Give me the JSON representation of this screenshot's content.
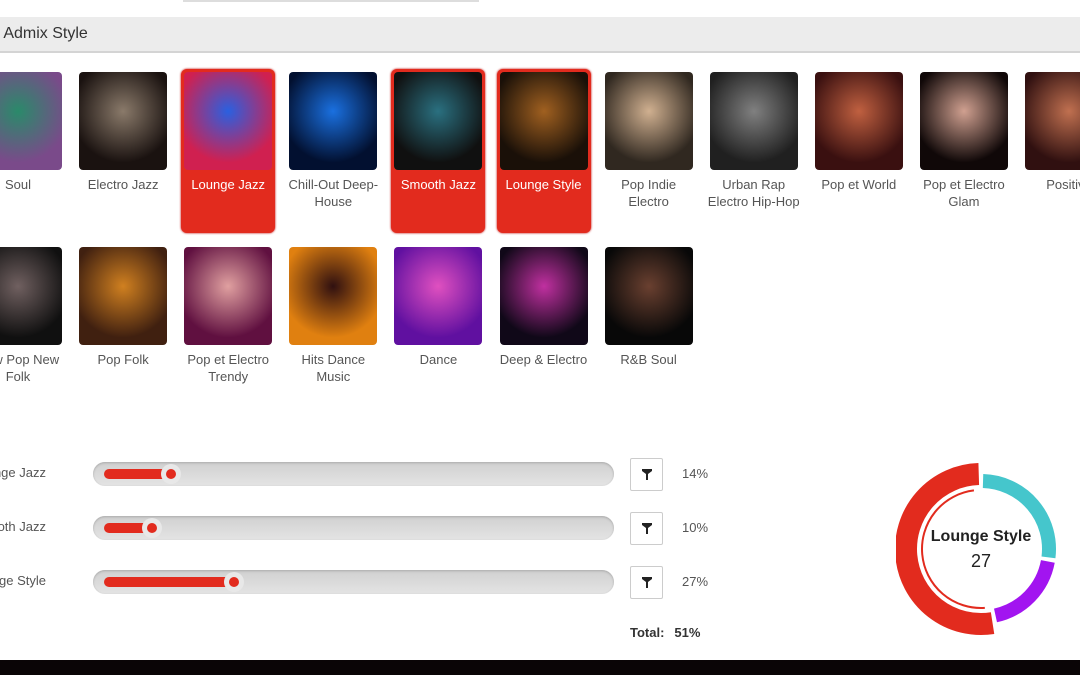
{
  "header": {
    "title": "Music Admix Style"
  },
  "styles": [
    {
      "label": "Soul",
      "selected": false,
      "colors": [
        "#7a4a8a",
        "#2a8a6a"
      ]
    },
    {
      "label": "Electro Jazz",
      "selected": false,
      "colors": [
        "#1a1210",
        "#8a7a6a"
      ]
    },
    {
      "label": "Lounge Jazz",
      "selected": true,
      "colors": [
        "#d02050",
        "#2a60e0"
      ]
    },
    {
      "label": "Chill-Out Deep-House",
      "selected": false,
      "colors": [
        "#021030",
        "#1a70e0"
      ]
    },
    {
      "label": "Smooth Jazz",
      "selected": true,
      "colors": [
        "#101010",
        "#2a7080"
      ]
    },
    {
      "label": "Lounge Style",
      "selected": true,
      "colors": [
        "#1a1008",
        "#a06020"
      ]
    },
    {
      "label": "Pop Indie Electro",
      "selected": false,
      "colors": [
        "#302820",
        "#d0b090"
      ]
    },
    {
      "label": "Urban Rap Electro Hip-Hop",
      "selected": false,
      "colors": [
        "#202020",
        "#808080"
      ]
    },
    {
      "label": "Pop et World",
      "selected": false,
      "colors": [
        "#3a1010",
        "#c06040"
      ]
    },
    {
      "label": "Pop et Electro Glam",
      "selected": false,
      "colors": [
        "#100808",
        "#d0a090"
      ]
    },
    {
      "label": "Positive",
      "selected": false,
      "colors": [
        "#301010",
        "#c07050"
      ]
    },
    {
      "label": "New Pop New Folk",
      "selected": false,
      "colors": [
        "#101010",
        "#706060"
      ]
    },
    {
      "label": "Pop Folk",
      "selected": false,
      "colors": [
        "#402010",
        "#d08020"
      ]
    },
    {
      "label": "Pop et Electro Trendy",
      "selected": false,
      "colors": [
        "#601040",
        "#e0a0a0"
      ]
    },
    {
      "label": "Hits Dance Music",
      "selected": false,
      "colors": [
        "#e08010",
        "#301010"
      ]
    },
    {
      "label": "Dance",
      "selected": false,
      "colors": [
        "#6010a0",
        "#e050c0"
      ]
    },
    {
      "label": "Deep & Electro",
      "selected": false,
      "colors": [
        "#100818",
        "#c030a0"
      ]
    },
    {
      "label": "R&B Soul",
      "selected": false,
      "colors": [
        "#080808",
        "#6a4030"
      ]
    }
  ],
  "mix": [
    {
      "label": "Lounge Jazz",
      "value": 14,
      "display": "14%",
      "color": "#45c6cc"
    },
    {
      "label": "Smooth Jazz",
      "value": 10,
      "display": "10%",
      "color": "#a214f0"
    },
    {
      "label": "Lounge Style",
      "value": 27,
      "display": "27%",
      "color": "#e22b1e"
    }
  ],
  "total": {
    "label": "Total:",
    "value": "51%"
  },
  "donut": {
    "label": "Lounge Style",
    "value": "27"
  },
  "accent": "#e22b1e"
}
